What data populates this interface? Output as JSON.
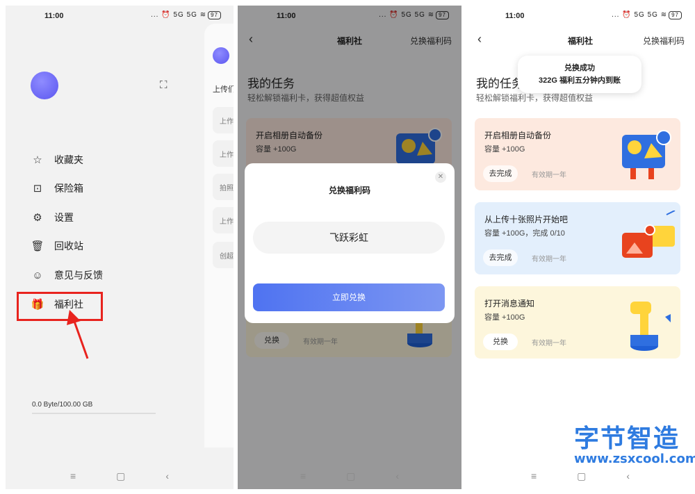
{
  "status_bar": {
    "time": "11:00",
    "icons": "... ⏰ 5G 5G ≋",
    "battery": "97"
  },
  "panel1": {
    "menu": [
      {
        "icon": "star-icon",
        "glyph": "☆",
        "label": "收藏夹"
      },
      {
        "icon": "safe-icon",
        "glyph": "⊡",
        "label": "保险箱"
      },
      {
        "icon": "gear-icon",
        "glyph": "⚙",
        "label": "设置"
      },
      {
        "icon": "trash-icon",
        "glyph": "🗑",
        "label": "回收站"
      },
      {
        "icon": "feedback-icon",
        "glyph": "☺",
        "label": "意见与反馈"
      },
      {
        "icon": "gift-icon",
        "glyph": "🎁",
        "label": "福利社"
      }
    ],
    "storage": "0.0 Byte/100.00 GB",
    "peek_labels": [
      "上传们",
      "上作",
      "上作",
      "拍照",
      "上作",
      "创超"
    ]
  },
  "header": {
    "title": "福利社",
    "redeem": "兑换福利码"
  },
  "tasks": {
    "heading": "我的任务",
    "subheading": "轻松解锁福利卡，获得超值权益",
    "cards": [
      {
        "title": "开启相册自动备份",
        "sub": "容量 +100G",
        "button": "去完成",
        "valid": "有效期一年",
        "color": "#fde9df"
      },
      {
        "title": "从上传十张照片开始吧",
        "sub": "容量 +100G，完成 0/10",
        "button": "去完成",
        "valid": "有效期一年",
        "color": "#e3effc"
      },
      {
        "title": "打开消息通知",
        "sub": "容量 +100G",
        "button": "兑换",
        "valid": "有效期一年",
        "color": "#fdf6dc"
      }
    ]
  },
  "dialog": {
    "title": "兑换福利码",
    "code": "飞跃彩虹",
    "button": "立即兑换"
  },
  "toast": {
    "line1": "兑换成功",
    "line2": "322G 福利五分钟内到账"
  },
  "navbar": {
    "menu": "≡",
    "home": "▢",
    "back": "‹"
  },
  "watermark": {
    "cn": "字节智造",
    "url": "www.zsxcool.com"
  },
  "colors": {
    "accent": "#4f73f1",
    "highlight": "#e8231e",
    "watermark": "#2e7be0"
  }
}
